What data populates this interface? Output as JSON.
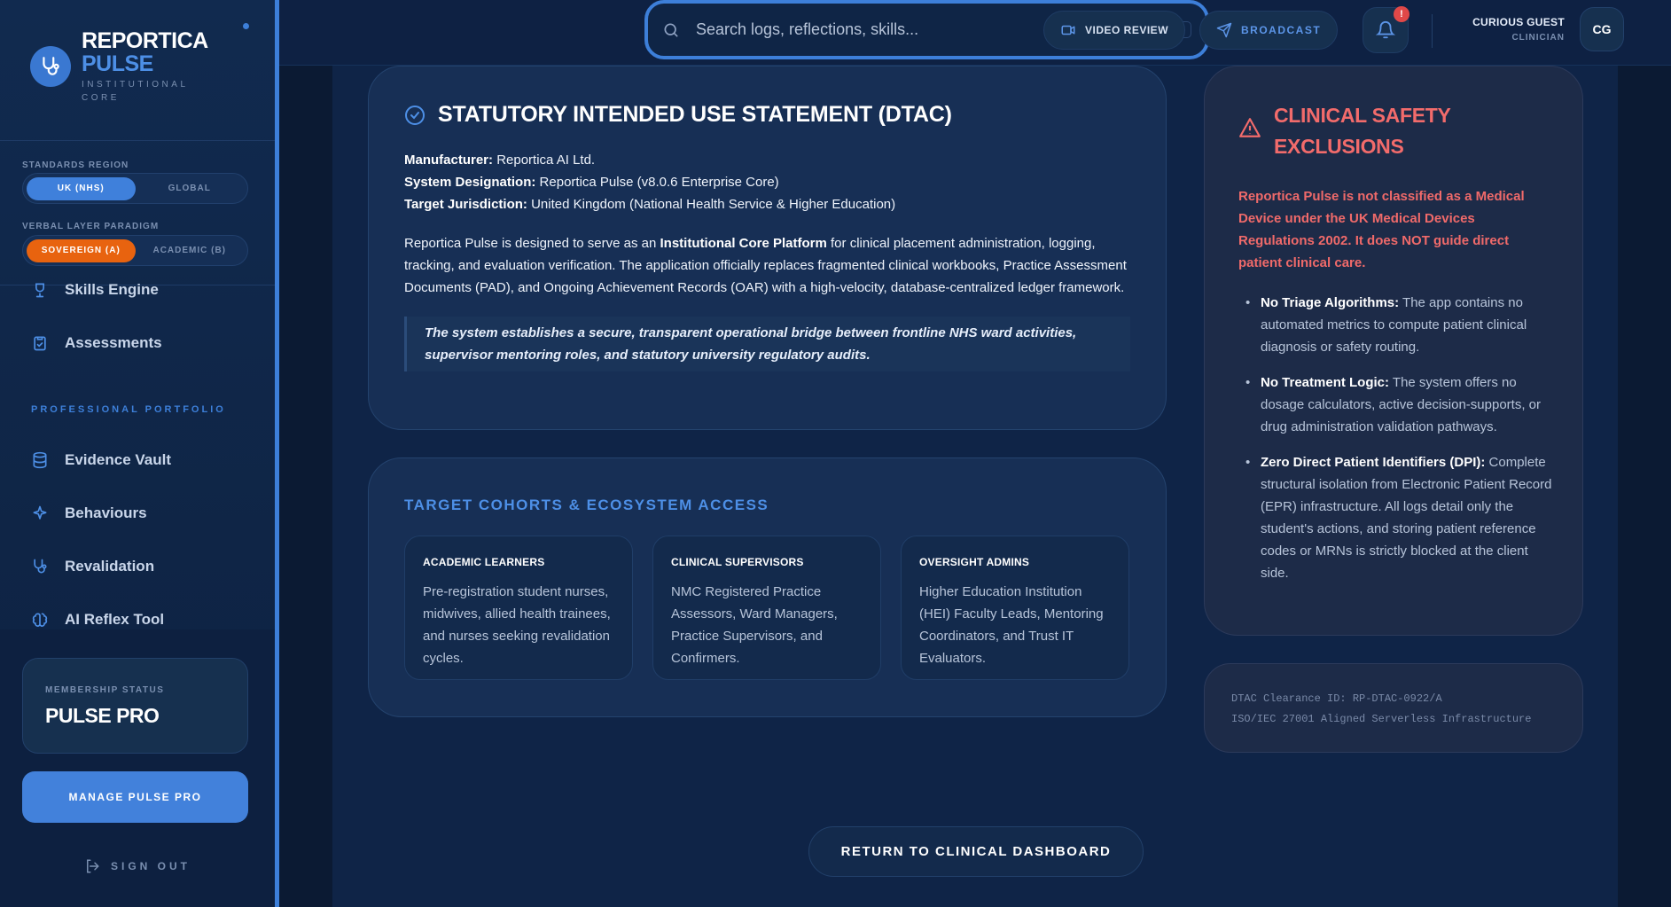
{
  "brand": {
    "name": "REPORTICA",
    "product": "PULSE",
    "tagline": "INSTITUTIONAL CORE"
  },
  "standards_region": {
    "label": "STANDARDS REGION",
    "options": [
      "UK (NHS)",
      "GLOBAL"
    ],
    "selected": "UK (NHS)"
  },
  "verbal_layer": {
    "label": "VERBAL LAYER PARADIGM",
    "options": [
      "SOVEREIGN (A)",
      "ACADEMIC (B)"
    ],
    "selected": "SOVEREIGN (A)"
  },
  "nav": {
    "items_top": [
      {
        "label": "Skills Engine",
        "icon": "trophy-icon"
      },
      {
        "label": "Assessments",
        "icon": "clipboard-icon"
      }
    ],
    "section_label": "PROFESSIONAL PORTFOLIO",
    "items_portfolio": [
      {
        "label": "Evidence Vault",
        "icon": "database-icon"
      },
      {
        "label": "Behaviours",
        "icon": "sparkle-icon"
      },
      {
        "label": "Revalidation",
        "icon": "stethoscope-icon"
      },
      {
        "label": "AI Reflex Tool",
        "icon": "brain-icon"
      }
    ]
  },
  "membership": {
    "label": "MEMBERSHIP STATUS",
    "value": "PULSE PRO",
    "manage_label": "MANAGE PULSE PRO"
  },
  "signout_label": "SIGN OUT",
  "topbar": {
    "search_placeholder": "Search logs, reflections, skills...",
    "search_shortcut": "CMD+K",
    "video_review_label": "VIDEO REVIEW",
    "broadcast_label": "BROADCAST",
    "notification_badge": "!",
    "user_name": "CURIOUS GUEST",
    "user_role": "CLINICIAN",
    "user_initials": "CG"
  },
  "dtac": {
    "title": "STATUTORY INTENDED USE STATEMENT (DTAC)",
    "manufacturer_label": "Manufacturer:",
    "manufacturer": "Reportica AI Ltd.",
    "designation_label": "System Designation:",
    "designation": "Reportica Pulse (v8.0.6 Enterprise Core)",
    "jurisdiction_label": "Target Jurisdiction:",
    "jurisdiction": "United Kingdom (National Health Service & Higher Education)",
    "body_pre": "Reportica Pulse is designed to serve as an",
    "body_strong": "Institutional Core Platform",
    "body_post": "for clinical placement administration, logging, tracking, and evaluation verification. The application officially replaces fragmented clinical workbooks, Practice Assessment Documents (PAD), and Ongoing Achievement Records (OAR) with a high-velocity, database-centralized ledger framework.",
    "quote": "The system establishes a secure, transparent operational bridge between frontline NHS ward activities, supervisor mentoring roles, and statutory university regulatory audits."
  },
  "cohorts": {
    "title": "TARGET COHORTS & ECOSYSTEM ACCESS",
    "items": [
      {
        "title": "ACADEMIC LEARNERS",
        "body": "Pre-registration student nurses, midwives, allied health trainees, and nurses seeking revalidation cycles."
      },
      {
        "title": "CLINICAL SUPERVISORS",
        "body": "NMC Registered Practice Assessors, Ward Managers, Practice Supervisors, and Confirmers."
      },
      {
        "title": "OVERSIGHT ADMINS",
        "body": "Higher Education Institution (HEI) Faculty Leads, Mentoring Coordinators, and Trust IT Evaluators."
      }
    ]
  },
  "safety": {
    "title": "CLINICAL SAFETY EXCLUSIONS",
    "lead": "Reportica Pulse is not classified as a Medical Device under the UK Medical Devices Regulations 2002. It does NOT guide direct patient clinical care.",
    "items": [
      {
        "label": "No Triage Algorithms:",
        "text": "The app contains no automated metrics to compute patient clinical diagnosis or safety routing."
      },
      {
        "label": "No Treatment Logic:",
        "text": "The system offers no dosage calculators, active decision-supports, or drug administration validation pathways."
      },
      {
        "label": "Zero Direct Patient Identifiers (DPI):",
        "text": "Complete structural isolation from Electronic Patient Record (EPR) infrastructure. All logs detail only the student's actions, and storing patient reference codes or MRNs is strictly blocked at the client side."
      }
    ]
  },
  "clearance": {
    "line1": "DTAC Clearance ID: RP-DTAC-0922/A",
    "line2": "ISO/IEC 27001 Aligned Serverless Infrastructure"
  },
  "return_label": "RETURN TO CLINICAL DASHBOARD",
  "colors": {
    "accent": "#3d7fd9",
    "orange": "#e8630f",
    "danger": "#f26b6b"
  }
}
